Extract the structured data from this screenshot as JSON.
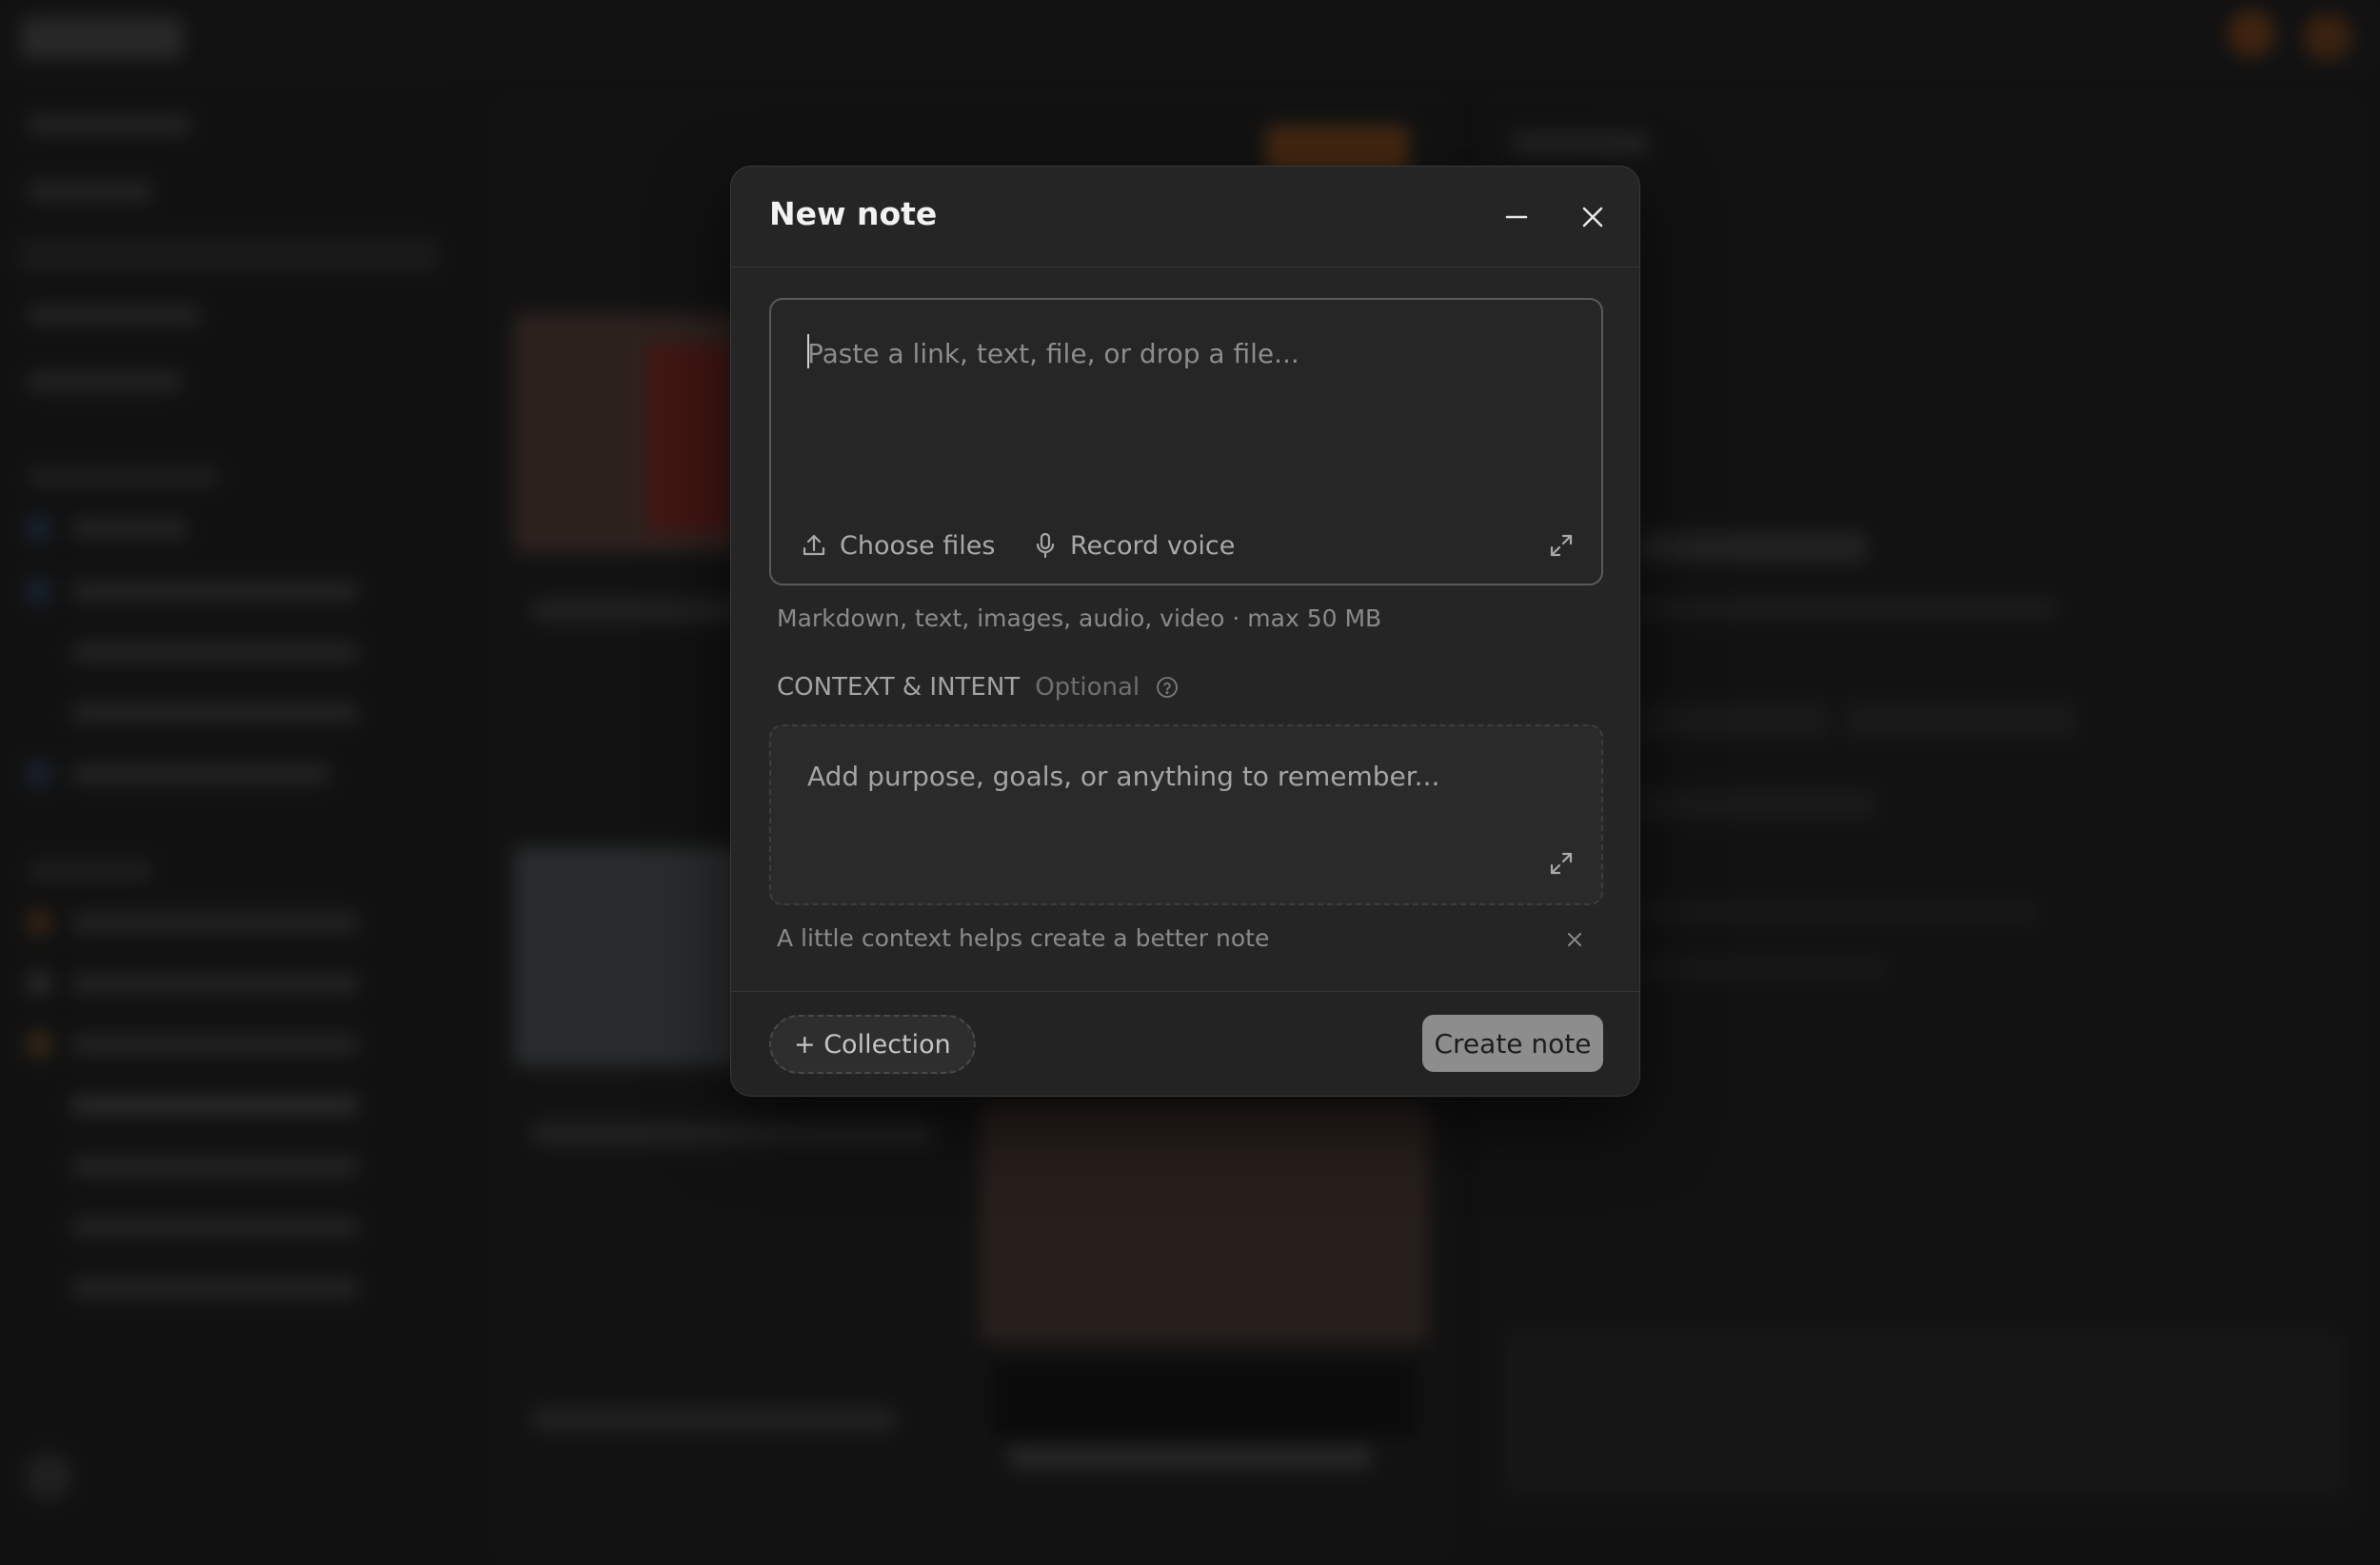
{
  "dialog": {
    "title": "New note",
    "minimize_icon": "minus-icon",
    "close_icon": "close-icon"
  },
  "paste": {
    "placeholder": "Paste a link, text, file, or drop a file...",
    "value": "",
    "choose_files_label": "Choose files",
    "choose_files_icon": "upload-icon",
    "record_voice_label": "Record voice",
    "record_voice_icon": "microphone-icon",
    "expand_icon": "expand-icon",
    "hint": "Markdown, text, images, audio, video · max 50 MB"
  },
  "context": {
    "label": "CONTEXT & INTENT",
    "optional_label": "Optional",
    "help_icon": "help-circle-icon",
    "placeholder": "Add purpose, goals, or anything to remember...",
    "value": "",
    "expand_icon": "expand-icon",
    "hint": "A little context helps create a better note",
    "dismiss_icon": "close-icon"
  },
  "footer": {
    "collection_label": "+ Collection",
    "create_label": "Create note"
  },
  "colors": {
    "modal_bg": "#252525",
    "create_button_bg": "#8d8d8d",
    "background_accent": "#a85a1c"
  }
}
